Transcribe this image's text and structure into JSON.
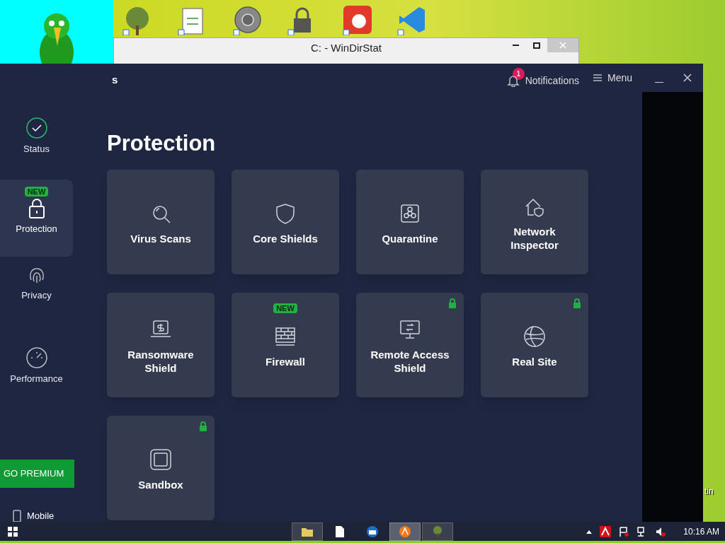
{
  "background_window": {
    "title": "C: - WinDirStat"
  },
  "app": {
    "title": "s",
    "notifications": {
      "label": "Notifications",
      "count": "1"
    },
    "menu": "Menu",
    "sidebar": [
      {
        "kind": "status",
        "label": "Status",
        "selected": false
      },
      {
        "kind": "protection",
        "label": "Protection",
        "selected": true,
        "badge": "NEW"
      },
      {
        "kind": "privacy",
        "label": "Privacy",
        "selected": false
      },
      {
        "kind": "performance",
        "label": "Performance",
        "selected": false
      }
    ],
    "premium_button": "GO PREMIUM",
    "mobile": "Mobile",
    "heading": "Protection",
    "tiles": [
      {
        "kind": "scan",
        "label": "Virus Scans",
        "locked": false
      },
      {
        "kind": "shield",
        "label": "Core Shields",
        "locked": false
      },
      {
        "kind": "quarantine",
        "label": "Quarantine",
        "locked": false
      },
      {
        "kind": "network",
        "label": "Network Inspector",
        "locked": false
      },
      {
        "kind": "ransomware",
        "label": "Ransomware Shield",
        "locked": false
      },
      {
        "kind": "firewall",
        "label": "Firewall",
        "locked": false,
        "badge": "NEW"
      },
      {
        "kind": "remote",
        "label": "Remote Access Shield",
        "locked": true
      },
      {
        "kind": "globe",
        "label": "Real Site",
        "locked": true
      },
      {
        "kind": "sandbox",
        "label": "Sandbox",
        "locked": true
      }
    ]
  },
  "desktop_label": "tin",
  "taskbar": {
    "apps": [
      {
        "kind": "folder",
        "open": true,
        "selected": false
      },
      {
        "kind": "file",
        "open": false,
        "selected": false
      },
      {
        "kind": "mail",
        "open": false,
        "selected": false
      },
      {
        "kind": "avast",
        "open": true,
        "selected": true
      },
      {
        "kind": "tree",
        "open": true,
        "selected": false
      }
    ],
    "time": "10:16 AM"
  }
}
